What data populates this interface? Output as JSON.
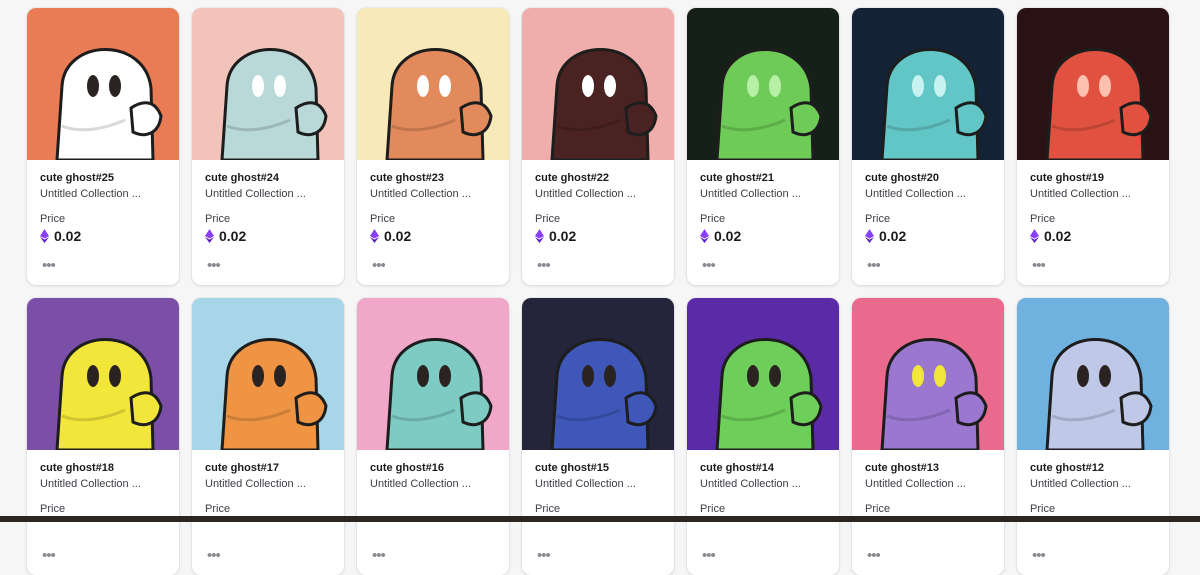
{
  "items": [
    {
      "name": "cute ghost#25",
      "collection": "Untitled Collection ...",
      "price_label": "Price",
      "price": "0.02",
      "bg": "#ea7c55",
      "body": "#ffffff",
      "eyes": "#2b2222"
    },
    {
      "name": "cute ghost#24",
      "collection": "Untitled Collection ...",
      "price_label": "Price",
      "price": "0.02",
      "bg": "#f2c3b8",
      "body": "#b9d8d8",
      "eyes": "#ffffff"
    },
    {
      "name": "cute ghost#23",
      "collection": "Untitled Collection ...",
      "price_label": "Price",
      "price": "0.02",
      "bg": "#f8eab8",
      "body": "#e28a5c",
      "eyes": "#ffffff"
    },
    {
      "name": "cute ghost#22",
      "collection": "Untitled Collection ...",
      "price_label": "Price",
      "price": "0.02",
      "bg": "#efaeab",
      "body": "#4a2222",
      "eyes": "#ffffff"
    },
    {
      "name": "cute ghost#21",
      "collection": "Untitled Collection ...",
      "price_label": "Price",
      "price": "0.02",
      "bg": "#142018",
      "body": "#6fcb58",
      "eyes": "#b6f0a4"
    },
    {
      "name": "cute ghost#20",
      "collection": "Untitled Collection ...",
      "price_label": "Price",
      "price": "0.02",
      "bg": "#142236",
      "body": "#63c6c6",
      "eyes": "#c8f2f2"
    },
    {
      "name": "cute ghost#19",
      "collection": "Untitled Collection ...",
      "price_label": "Price",
      "price": "0.02",
      "bg": "#2a1214",
      "body": "#e0523f",
      "eyes": "#ffc0b0"
    },
    {
      "name": "cute ghost#18",
      "collection": "Untitled Collection ...",
      "price_label": "Price",
      "price": "",
      "bg": "#7b4ea8",
      "body": "#f3e63a",
      "eyes": "#2b2222"
    },
    {
      "name": "cute ghost#17",
      "collection": "Untitled Collection ...",
      "price_label": "Price",
      "price": "",
      "bg": "#a6d6e8",
      "body": "#ee9442",
      "eyes": "#2b2222"
    },
    {
      "name": "cute ghost#16",
      "collection": "Untitled Collection ...",
      "price_label": "",
      "price": "",
      "bg": "#f0a7c8",
      "body": "#7dcbc2",
      "eyes": "#2b2222"
    },
    {
      "name": "cute ghost#15",
      "collection": "Untitled Collection ...",
      "price_label": "Price",
      "price": "",
      "bg": "#24243a",
      "body": "#3f57b8",
      "eyes": "#2b2222"
    },
    {
      "name": "cute ghost#14",
      "collection": "Untitled Collection ...",
      "price_label": "Price",
      "price": "",
      "bg": "#5b2aa6",
      "body": "#6dcf5a",
      "eyes": "#2b2222"
    },
    {
      "name": "cute ghost#13",
      "collection": "Untitled Collection ...",
      "price_label": "Price",
      "price": "",
      "bg": "#ea6a8e",
      "body": "#9a78d0",
      "eyes": "#f3e63a"
    },
    {
      "name": "cute ghost#12",
      "collection": "Untitled Collection ...",
      "price_label": "Price",
      "price": "",
      "bg": "#6fb2e0",
      "body": "#c0c8e8",
      "eyes": "#2b2222"
    }
  ],
  "more_glyph": "•••",
  "colors": {
    "eth_purple": "#8a3ffc",
    "eth_dark": "#5b1fc7"
  }
}
